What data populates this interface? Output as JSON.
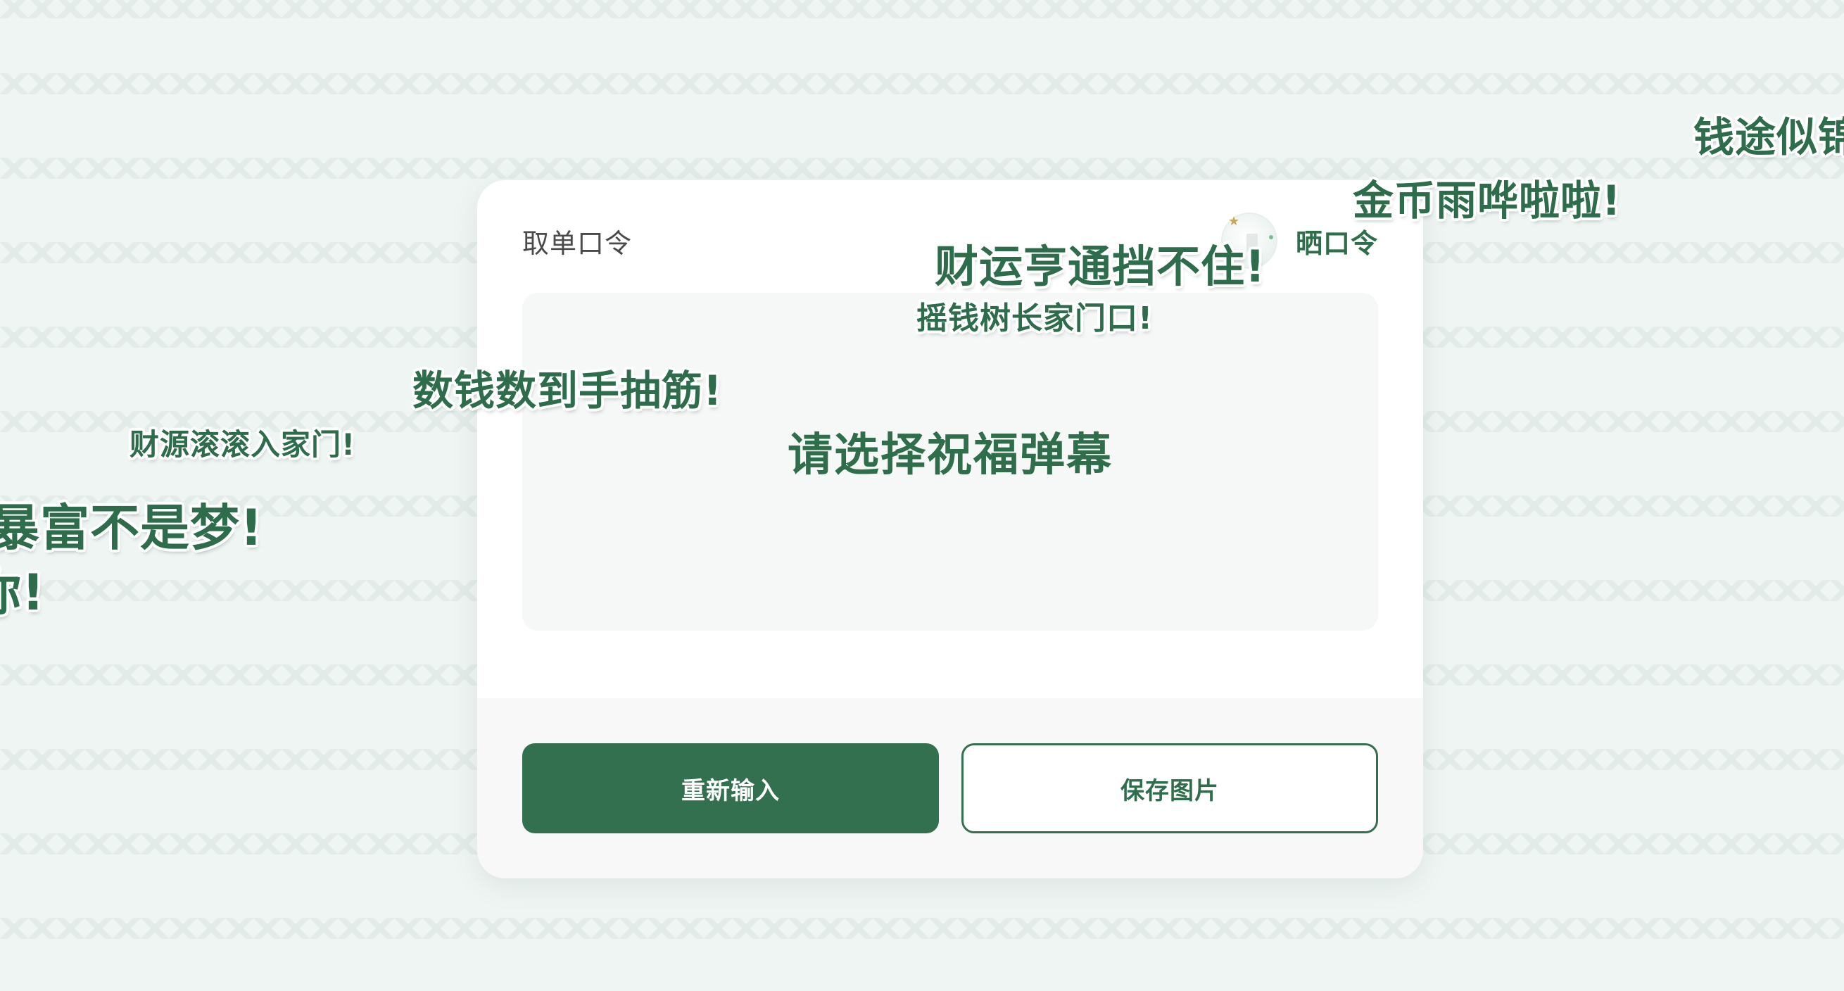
{
  "card": {
    "header_left": "取单口令",
    "header_right": "晒口令",
    "message": "请选择祝福弹幕"
  },
  "buttons": {
    "reenter": "重新输入",
    "save_image": "保存图片"
  },
  "danmaku": [
    "钱途似锦",
    "金币雨哗啦啦!",
    "财运亨通挡不住!",
    "摇钱树长家门口!",
    "数钱数到手抽筋!",
    "财源滚滚入家门!",
    "暴富不是梦!",
    "你!"
  ],
  "colors": {
    "brand_green": "#33704f",
    "background": "#eff5f3",
    "card": "#ffffff"
  }
}
